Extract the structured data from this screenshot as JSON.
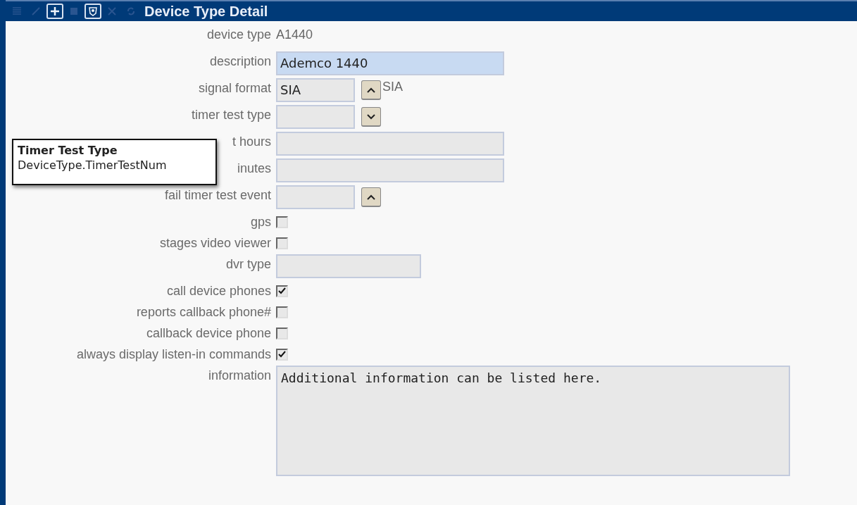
{
  "window": {
    "title": "Device Type Detail"
  },
  "toolbar": [
    {
      "kind": "list",
      "disabled": true
    },
    {
      "kind": "edit",
      "disabled": true
    },
    {
      "kind": "add",
      "disabled": false
    },
    {
      "kind": "save",
      "disabled": true
    },
    {
      "kind": "shield",
      "disabled": false
    },
    {
      "kind": "delete",
      "disabled": true
    },
    {
      "kind": "refresh",
      "disabled": true
    }
  ],
  "fields": [
    {
      "kind": "text",
      "label": "device type",
      "value": "A1440"
    },
    {
      "kind": "wide",
      "label": "description",
      "value": "Ademco 1440",
      "focused": true
    },
    {
      "kind": "select",
      "label": "signal format",
      "value": "SIA",
      "expanded": true,
      "note": "SIA"
    },
    {
      "kind": "select",
      "label": "timer test type",
      "expanded": false
    },
    {
      "kind": "wide",
      "label": "t hours",
      "focused": false
    },
    {
      "kind": "wide",
      "label": "inutes",
      "focused": false
    },
    {
      "kind": "select",
      "label": "fail timer test event",
      "expanded": true
    },
    {
      "kind": "checkbox",
      "label": "gps",
      "checked": false
    },
    {
      "kind": "checkbox",
      "label": "stages video viewer",
      "checked": false
    },
    {
      "kind": "medium",
      "label": "dvr type",
      "focused": false
    },
    {
      "kind": "checkbox",
      "label": "call device phones",
      "checked": true
    },
    {
      "kind": "checkbox",
      "label": "reports callback phone#",
      "checked": false
    },
    {
      "kind": "checkbox",
      "label": "callback device phone",
      "checked": false
    },
    {
      "kind": "checkbox",
      "label": "always display listen-in commands",
      "checked": true
    },
    {
      "kind": "textarea",
      "label": "information",
      "value": "Additional information can be listed here."
    }
  ],
  "tooltip": {
    "title": "Timer Test Type",
    "text": "DeviceType.TimerTestNum"
  }
}
